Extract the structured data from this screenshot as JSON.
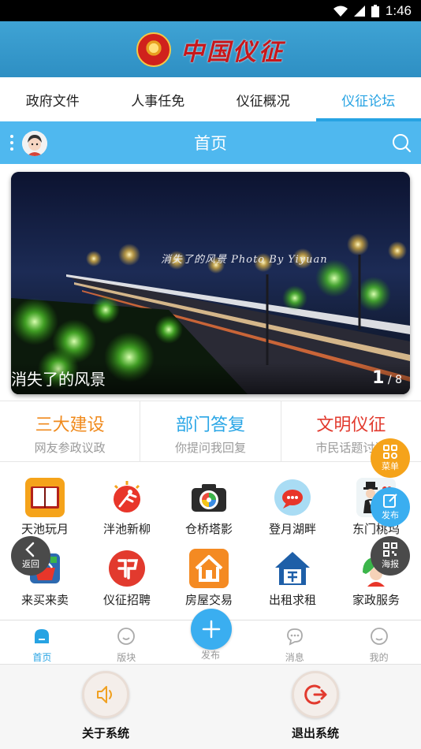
{
  "status_bar": {
    "time": "1:46"
  },
  "header": {
    "title": "中国仪征"
  },
  "top_tabs": [
    {
      "label": "政府文件",
      "active": false
    },
    {
      "label": "人事任免",
      "active": false
    },
    {
      "label": "仪征概况",
      "active": false
    },
    {
      "label": "仪征论坛",
      "active": true
    }
  ],
  "page_bar": {
    "title": "首页"
  },
  "banner": {
    "watermark": "消失了的风景  Photo By Yiyuan",
    "caption": "消失了的风景",
    "page_current": "1",
    "page_total": "/ 8"
  },
  "features": [
    {
      "title": "三大建设",
      "subtitle": "网友参政议政",
      "color": "#f08a1c"
    },
    {
      "title": "部门答复",
      "subtitle": "你提问我回复",
      "color": "#2aa6e6"
    },
    {
      "title": "文明仪征",
      "subtitle": "市民话题讨论",
      "color": "#e23a2e"
    }
  ],
  "grid": [
    {
      "label": "天池玩月",
      "icon": "book-icon"
    },
    {
      "label": "泮池新柳",
      "icon": "runner-icon"
    },
    {
      "label": "仓桥塔影",
      "icon": "camera-icon"
    },
    {
      "label": "登月湖畔",
      "icon": "chat-icon"
    },
    {
      "label": "东门桃坞",
      "icon": "couple-icon"
    },
    {
      "label": "来买来卖",
      "icon": "basket-icon"
    },
    {
      "label": "仪征招聘",
      "icon": "hire-icon"
    },
    {
      "label": "房屋交易",
      "icon": "house-icon"
    },
    {
      "label": "出租求租",
      "icon": "rent-icon"
    },
    {
      "label": "家政服务",
      "icon": "service-icon"
    }
  ],
  "float_buttons": {
    "menu": "菜单",
    "post": "发布",
    "poster": "海报",
    "back": "返回"
  },
  "bottom_nav": [
    {
      "label": "首页",
      "active": true
    },
    {
      "label": "版块",
      "active": false
    },
    {
      "label": "发布",
      "active": false
    },
    {
      "label": "消息",
      "active": false
    },
    {
      "label": "我的",
      "active": false
    }
  ],
  "system_bar": {
    "about": "关于系统",
    "exit": "退出系统"
  },
  "colors": {
    "accent": "#27a3e3",
    "page_bar": "#4fb8ef",
    "menu_orange": "#f5a31a",
    "post_blue": "#3aaef0",
    "dark_grey": "#4a4a4a"
  }
}
